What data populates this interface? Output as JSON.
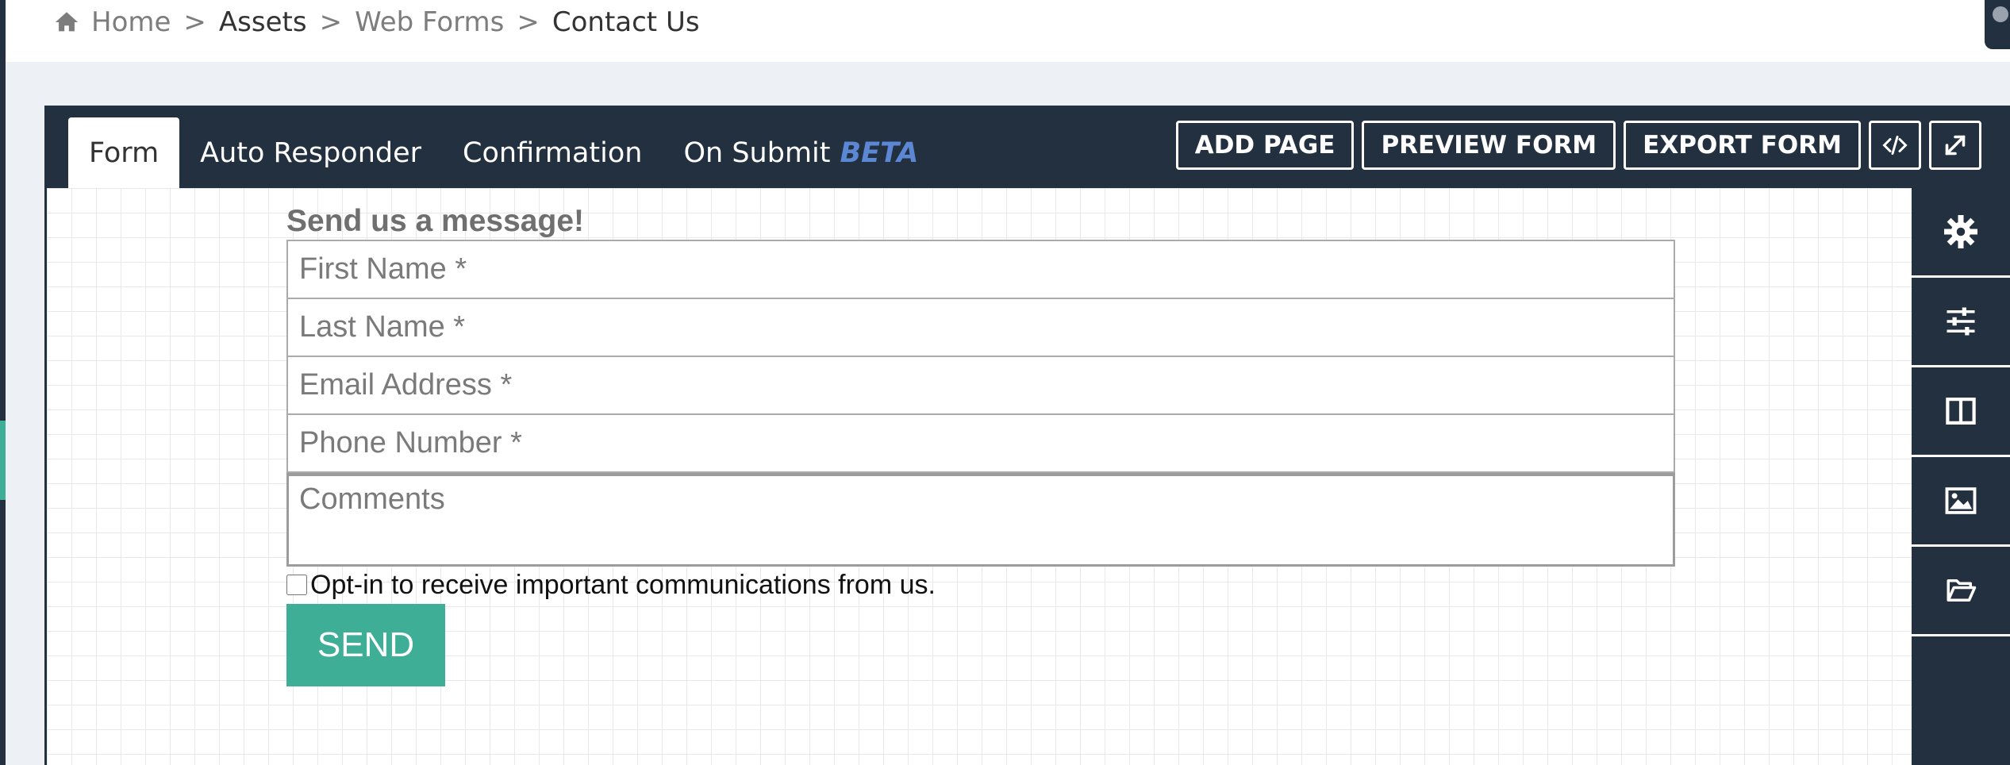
{
  "breadcrumb": {
    "items": [
      "Home",
      "Assets",
      "Web Forms",
      "Contact Us"
    ],
    "separator": ">"
  },
  "tabs": [
    {
      "label": "Form",
      "active": true
    },
    {
      "label": "Auto Responder",
      "active": false
    },
    {
      "label": "Confirmation",
      "active": false
    },
    {
      "label": "On Submit",
      "badge": "BETA",
      "active": false
    }
  ],
  "actions": {
    "add_page": "ADD PAGE",
    "preview_form": "PREVIEW FORM",
    "export_form": "EXPORT FORM",
    "code_icon": "code-icon",
    "expand_icon": "expand-icon"
  },
  "side_toolbar": [
    "gear-icon",
    "sliders-icon",
    "columns-icon",
    "image-icon",
    "folder-open-icon"
  ],
  "form": {
    "title": "Send us a message!",
    "fields": {
      "first_name": "First Name *",
      "last_name": "Last Name *",
      "email": "Email Address *",
      "phone": "Phone Number *",
      "comments": "Comments"
    },
    "optin_label": "Opt-in to receive important communications from us.",
    "optin_checked": false,
    "submit_label": "SEND"
  },
  "colors": {
    "panel": "#22303f",
    "accent": "#3fae97",
    "beta": "#5b87d4",
    "background": "#edf0f4"
  }
}
